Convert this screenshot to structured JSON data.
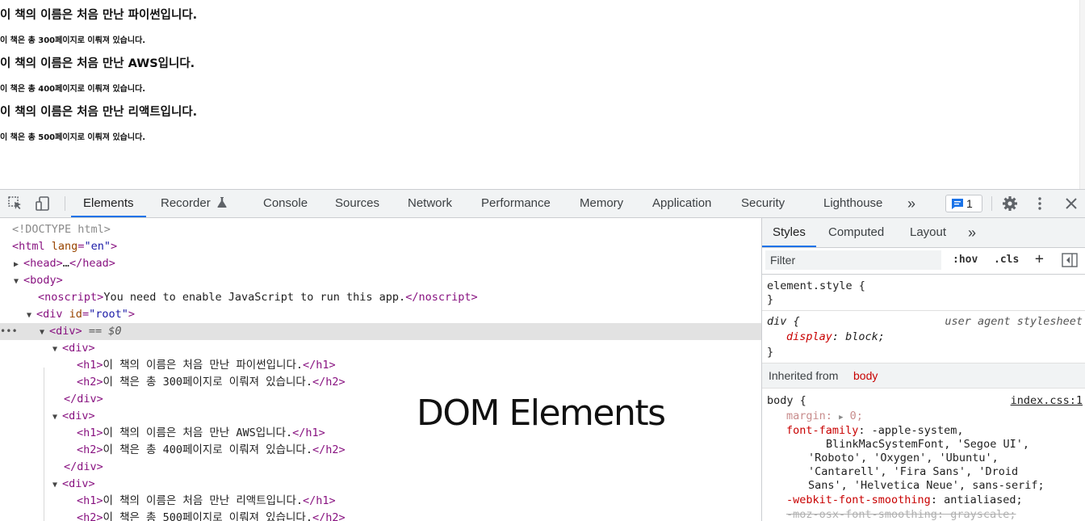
{
  "page": {
    "books": [
      {
        "title": "이 책의 이름은 처음 만난 파이썬입니다.",
        "pages": "이 책은 총 300페이지로 이뤄져 있습니다."
      },
      {
        "title": "이 책의 이름은 처음 만난 AWS입니다.",
        "pages": "이 책은 총 400페이지로 이뤄져 있습니다."
      },
      {
        "title": "이 책의 이름은 처음 만난 리액트입니다.",
        "pages": "이 책은 총 500페이지로 이뤄져 있습니다."
      }
    ]
  },
  "devtools": {
    "tabs": [
      "Elements",
      "Recorder",
      "Console",
      "Sources",
      "Network",
      "Performance",
      "Memory",
      "Application",
      "Security",
      "Lighthouse"
    ],
    "more_tabs": "»",
    "message_count": "1",
    "icons": {
      "inspect": "inspect-element-icon",
      "device": "device-toolbar-icon",
      "settings": "gear-icon",
      "menu": "kebab-menu-icon",
      "close": "close-icon"
    },
    "accent_color": "#1a73e8"
  },
  "elements": {
    "doctype": "<!DOCTYPE html>",
    "html_tag": "html",
    "html_attr_name": "lang",
    "html_attr_value": "\"en\"",
    "head_tag": "head",
    "head_ellipsis": "…",
    "body_tag": "body",
    "noscript_tag": "noscript",
    "noscript_text": "You need to enable JavaScript to run this app.",
    "root_tag": "div",
    "root_attr_name": "id",
    "root_attr_value": "\"root\"",
    "selected_tag": "div",
    "selected_ref": "== $0",
    "book_nodes": [
      {
        "h1": "이 책의 이름은 처음 만난 파이썬입니다.",
        "h2": "이 책은 총 300페이지로 이뤄져 있습니다."
      },
      {
        "h1": "이 책의 이름은 처음 만난 AWS입니다.",
        "h2": "이 책은 총 400페이지로 이뤄져 있습니다."
      },
      {
        "h1": "이 책의 이름은 처음 만난 리액트입니다.",
        "h2": "이 책은 총 500페이지로 이뤄져 있습니다."
      }
    ],
    "overlay_title": "DOM Elements"
  },
  "styles": {
    "tabs": [
      "Styles",
      "Computed",
      "Layout"
    ],
    "more_tabs": "»",
    "filter_placeholder": "Filter",
    "hov_label": ":hov",
    "cls_label": ".cls",
    "add_rule": "+",
    "element_style_selector": "element.style {",
    "close_brace": "}",
    "div_selector": "div {",
    "div_source": "user agent stylesheet",
    "div_prop": "display",
    "div_value": "block;",
    "inherited_label": "Inherited from",
    "inherited_selector": "body",
    "body_selector": "body {",
    "body_source": "index.css:1",
    "margin_prop": "margin",
    "margin_value": "0;",
    "font_family_prop": "font-family",
    "font_family_lines": [
      "-apple-system,",
      "BlinkMacSystemFont, 'Segoe UI',",
      "'Roboto', 'Oxygen', 'Ubuntu',",
      "'Cantarell', 'Fira Sans', 'Droid",
      "Sans', 'Helvetica Neue', sans-serif;"
    ],
    "smoothing_prop": "-webkit-font-smoothing",
    "smoothing_value": "antialiased;",
    "moz_smoothing": "-moz-osx-font-smoothing: grayscale;"
  }
}
